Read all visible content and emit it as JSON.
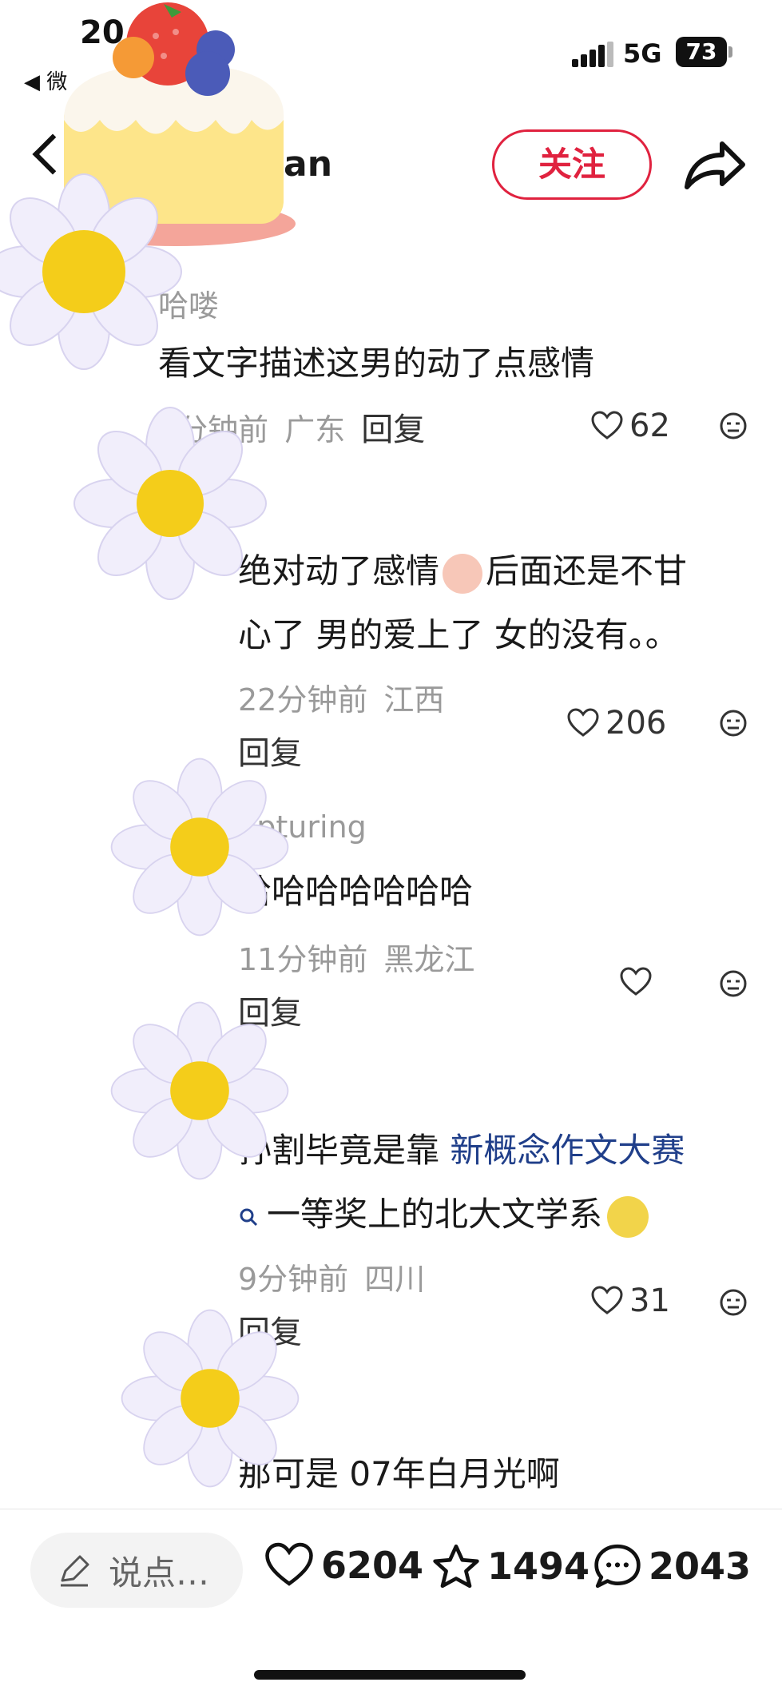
{
  "status_bar": {
    "time_fragment": "20",
    "back_app": "◀ 微",
    "network": "5G",
    "battery": "73"
  },
  "header": {
    "username_fragment": "an",
    "follow_label": "关注"
  },
  "comments": [
    {
      "username": "哈喽",
      "text": "看文字描述这男的动了点感情",
      "time": "3分钟前",
      "location": "广东",
      "reply_label": "回复",
      "likes": "62"
    },
    {
      "username": "d",
      "text_line1": "绝对动了感情",
      "text_line1b": "后面还是不甘",
      "text_line2": "心了 男的爱上了 女的没有。。",
      "time": "22分钟前",
      "location": "江西",
      "reply_label": "回复",
      "likes": "206"
    },
    {
      "username": "apturing",
      "text": "哈哈哈哈哈哈哈",
      "time": "11分钟前",
      "location": "黑龙江",
      "reply_label": "回复",
      "likes": ""
    },
    {
      "username": "",
      "text_pre": "孙割毕竟是靠 ",
      "topic": "新概念作文大赛",
      "text_line2": "一等奖上的北大文学系",
      "time": "9分钟前",
      "location": "四川",
      "reply_label": "回复",
      "likes": "31"
    },
    {
      "username": "",
      "text": "那可是 07年白月光啊"
    }
  ],
  "bottom_bar": {
    "input_placeholder": "说点…",
    "likes": "6204",
    "favorites": "1494",
    "comments": "2043"
  },
  "icons": [
    "back-icon",
    "share-icon",
    "heart-icon",
    "dislike-icon",
    "search-icon",
    "pencil-icon",
    "star-icon",
    "comment-bubble-icon"
  ],
  "colors": {
    "follow_accent": "#e0223f",
    "topic_link": "#203f8a",
    "meta_gray": "#9a9a9a"
  }
}
